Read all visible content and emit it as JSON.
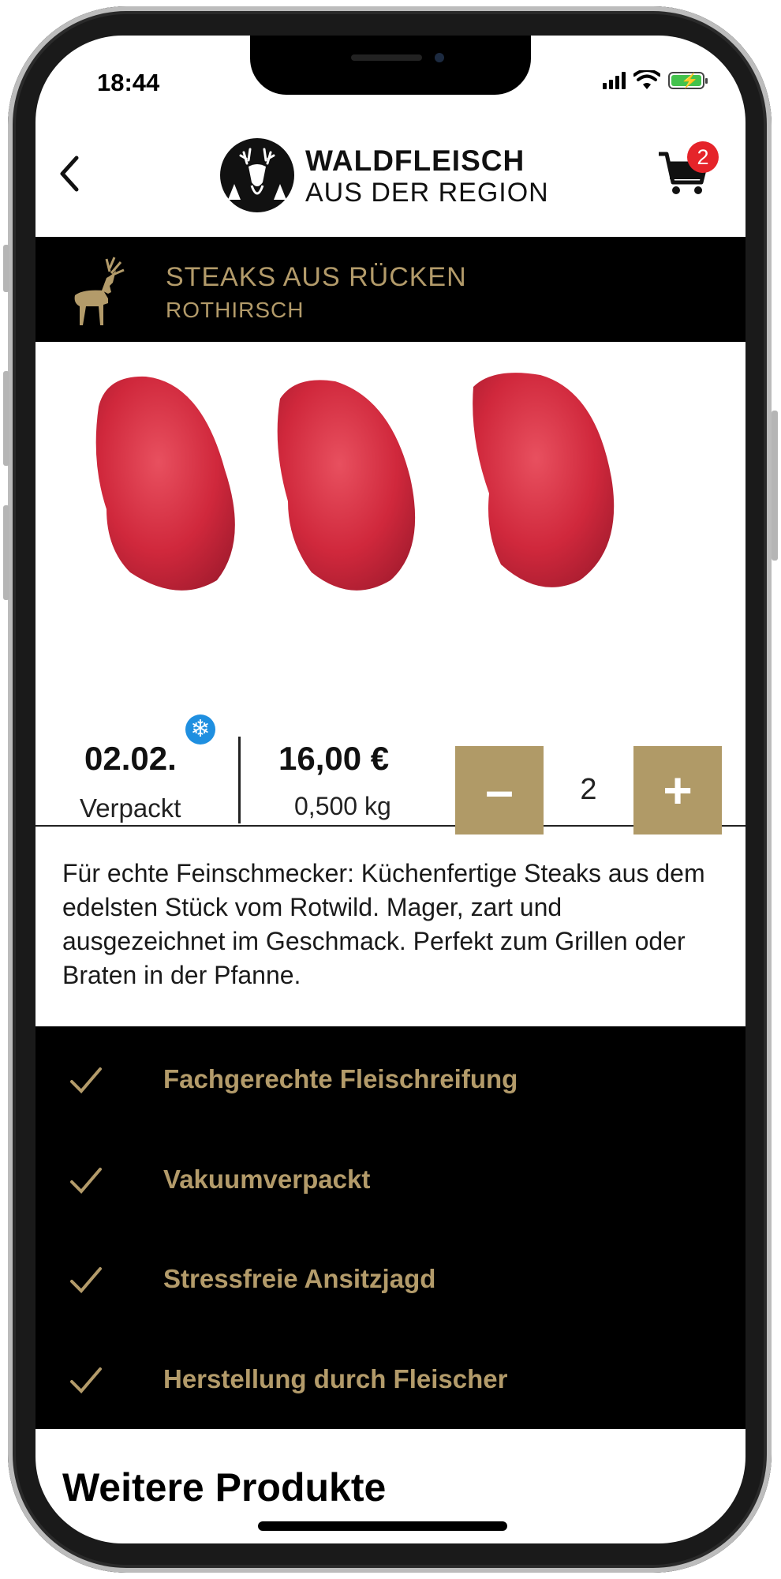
{
  "status_bar": {
    "time": "18:44"
  },
  "header": {
    "logo_title": "WALDFLEISCH",
    "logo_subtitle": "AUS DER REGION",
    "cart_count": "2"
  },
  "category": {
    "title": "STEAKS AUS RÜCKEN",
    "subtitle": "ROTHIRSCH"
  },
  "product": {
    "date": "02.02.",
    "date_label": "Verpackt",
    "price": "16,00 €",
    "weight": "0,500 kg",
    "quantity": "2",
    "minus_label": "–",
    "plus_label": "+",
    "description": "Für echte Feinschmecker: Küchenfertige Steaks aus dem edelsten Stück vom Rotwild. Mager, zart und ausgezeichnet im Geschmack. Perfekt zum Grillen oder Braten in der Pfanne."
  },
  "features": [
    {
      "label": "Fachgerechte Fleischreifung"
    },
    {
      "label": "Vakuumverpackt"
    },
    {
      "label": "Stressfreie Ansitzjagd"
    },
    {
      "label": "Herstellung durch Fleischer"
    }
  ],
  "more_products": {
    "title": "Weitere Produkte"
  },
  "colors": {
    "accent": "#b09a67",
    "badge": "#e5242a",
    "frozen": "#1f8fe0"
  }
}
